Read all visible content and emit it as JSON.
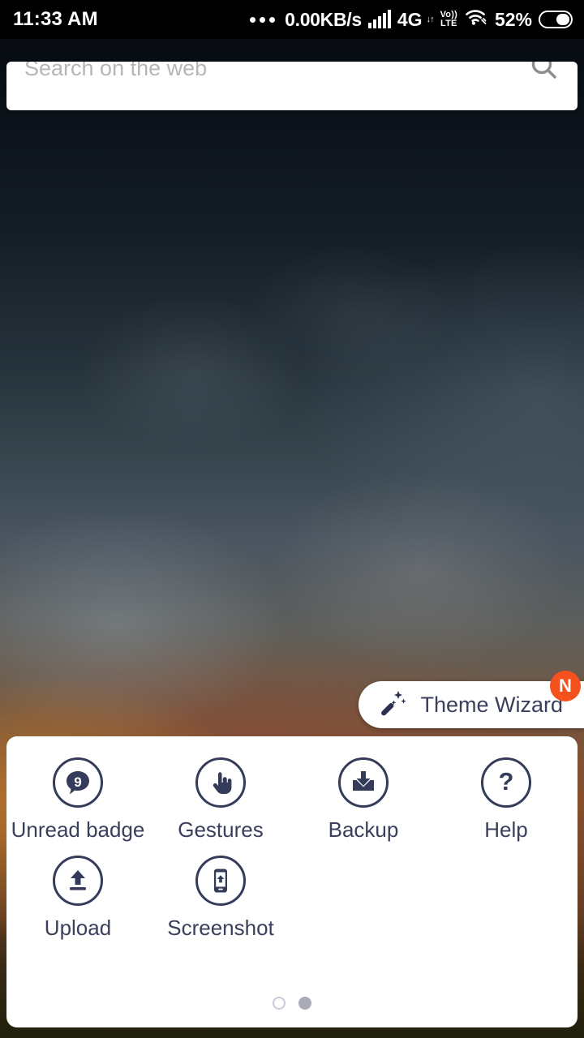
{
  "status_bar": {
    "time": "11:33 AM",
    "network_speed": "0.00KB/s",
    "network_type": "4G",
    "volte_top": "Vo))",
    "volte_bottom": "LTE",
    "battery_percent": "52%",
    "dots_icon": "more-horizontal-icon",
    "signal_icon": "cellular-signal-icon",
    "wifi_icon": "wifi-icon",
    "battery_icon": "battery-icon"
  },
  "search": {
    "placeholder": "Search on the web",
    "icon": "search-icon"
  },
  "theme_wizard": {
    "label": "Theme Wizard",
    "icon": "magic-wand-icon",
    "badge": "N",
    "badge_color": "#F4511E"
  },
  "tools": {
    "accent_color": "#353b5b",
    "items": [
      {
        "label": "Unread badge",
        "icon": "speech-bubble-badge-icon",
        "badge_count": "9"
      },
      {
        "label": "Gestures",
        "icon": "pointing-hand-icon"
      },
      {
        "label": "Backup",
        "icon": "download-tray-icon"
      },
      {
        "label": "Help",
        "icon": "question-mark-icon"
      },
      {
        "label": "Upload",
        "icon": "upload-arrow-icon"
      },
      {
        "label": "Screenshot",
        "icon": "phone-screenshot-icon"
      }
    ],
    "pager": {
      "total": 2,
      "active_index": 1
    }
  }
}
